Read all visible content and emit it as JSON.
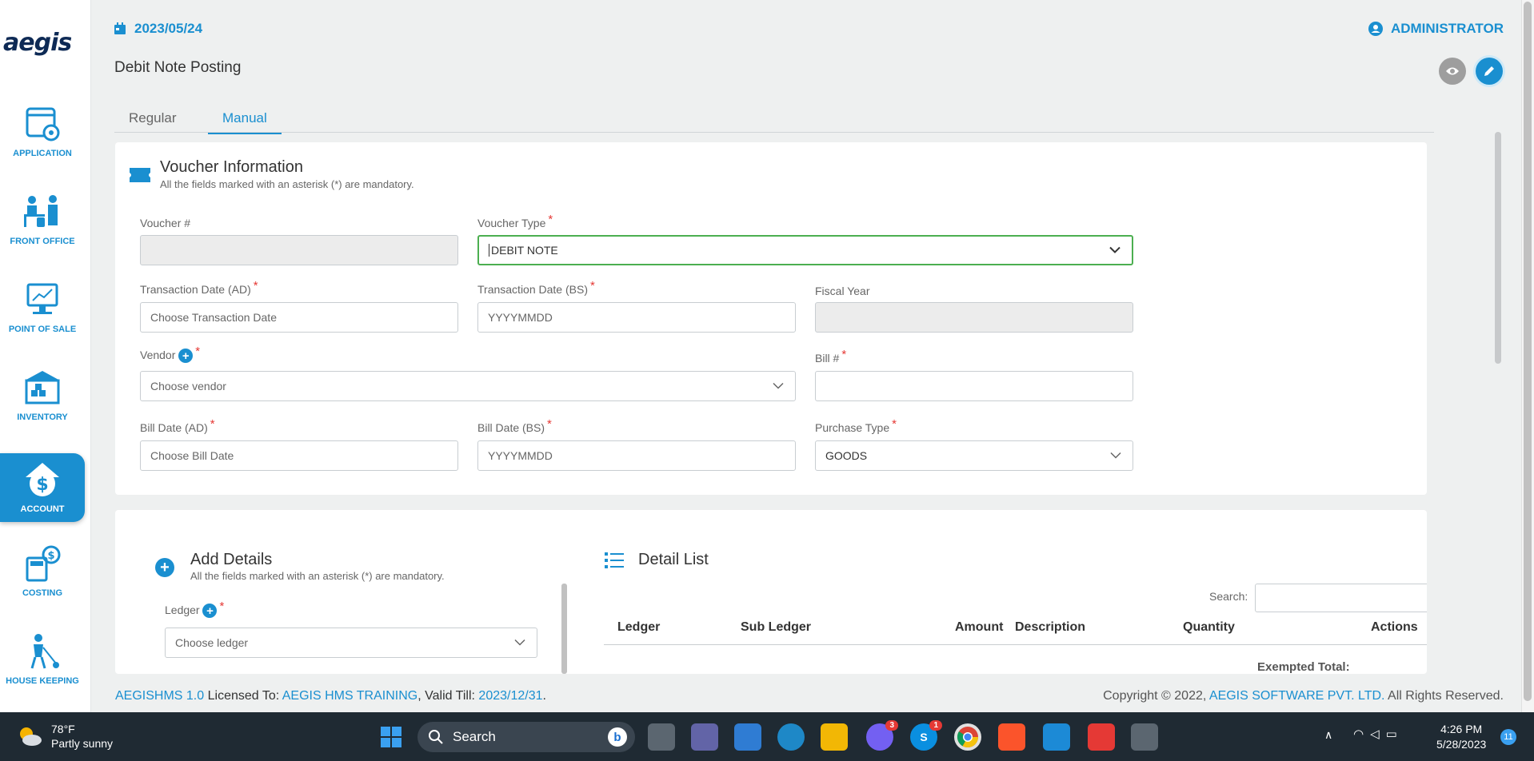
{
  "brand": {
    "logo_text": "aegis"
  },
  "sidebar": {
    "items": [
      {
        "label": "APPLICATION",
        "icon": "application-gear-icon"
      },
      {
        "label": "FRONT OFFICE",
        "icon": "front-office-icon"
      },
      {
        "label": "POINT OF SALE",
        "icon": "point-of-sale-icon"
      },
      {
        "label": "INVENTORY",
        "icon": "inventory-warehouse-icon"
      },
      {
        "label": "ACCOUNT",
        "icon": "account-dollar-icon",
        "active": true
      },
      {
        "label": "COSTING",
        "icon": "costing-calculator-icon"
      },
      {
        "label": "HOUSE KEEPING",
        "icon": "housekeeping-icon"
      }
    ]
  },
  "header": {
    "date": "2023/05/24",
    "user": "ADMINISTRATOR",
    "page_title": "Debit Note Posting"
  },
  "tabs": [
    {
      "label": "Regular"
    },
    {
      "label": "Manual",
      "active": true
    }
  ],
  "voucher": {
    "title": "Voucher Information",
    "subtitle": "All the fields marked with an asterisk (*) are mandatory.",
    "voucher_no": {
      "label": "Voucher #",
      "value": ""
    },
    "voucher_type": {
      "label": "Voucher Type",
      "value": "DEBIT NOTE"
    },
    "trans_date_ad": {
      "label": "Transaction Date (AD)",
      "placeholder": "Choose Transaction Date"
    },
    "trans_date_bs": {
      "label": "Transaction Date (BS)",
      "placeholder": "YYYYMMDD"
    },
    "fiscal_year": {
      "label": "Fiscal Year",
      "value": ""
    },
    "vendor": {
      "label": "Vendor",
      "placeholder": "Choose vendor"
    },
    "bill_no": {
      "label": "Bill #",
      "value": ""
    },
    "bill_date_ad": {
      "label": "Bill Date (AD)",
      "placeholder": "Choose Bill Date"
    },
    "bill_date_bs": {
      "label": "Bill Date (BS)",
      "placeholder": "YYYYMMDD"
    },
    "purchase_type": {
      "label": "Purchase Type",
      "value": "GOODS"
    }
  },
  "add_details": {
    "title": "Add Details",
    "subtitle": "All the fields marked with an asterisk (*) are mandatory.",
    "ledger": {
      "label": "Ledger",
      "placeholder": "Choose ledger"
    }
  },
  "detail_list": {
    "title": "Detail List",
    "search_label": "Search:",
    "columns": [
      "Ledger",
      "Sub Ledger",
      "Amount",
      "Description",
      "Quantity",
      "Actions"
    ],
    "exempted_total_label": "Exempted Total:"
  },
  "footer": {
    "product": "AEGISHMS 1.0",
    "licensed_to_label": "Licensed To:",
    "licensee": "AEGIS HMS TRAINING",
    "valid_till_label": ", Valid Till:",
    "valid_till": "2023/12/31",
    "period": ".",
    "copyright": "Copyright © 2022,",
    "company": "AEGIS SOFTWARE PVT. LTD.",
    "rights": "All Rights Reserved."
  },
  "taskbar": {
    "weather_temp": "78°F",
    "weather_desc": "Partly sunny",
    "search_label": "Search",
    "time": "4:26 PM",
    "date": "5/28/2023",
    "notif_count": "11",
    "viber_badge": "3",
    "skype_badge": "1"
  },
  "colors": {
    "accent": "#1a8fd0",
    "required": "#e53935",
    "focus_border": "#4caf50"
  }
}
